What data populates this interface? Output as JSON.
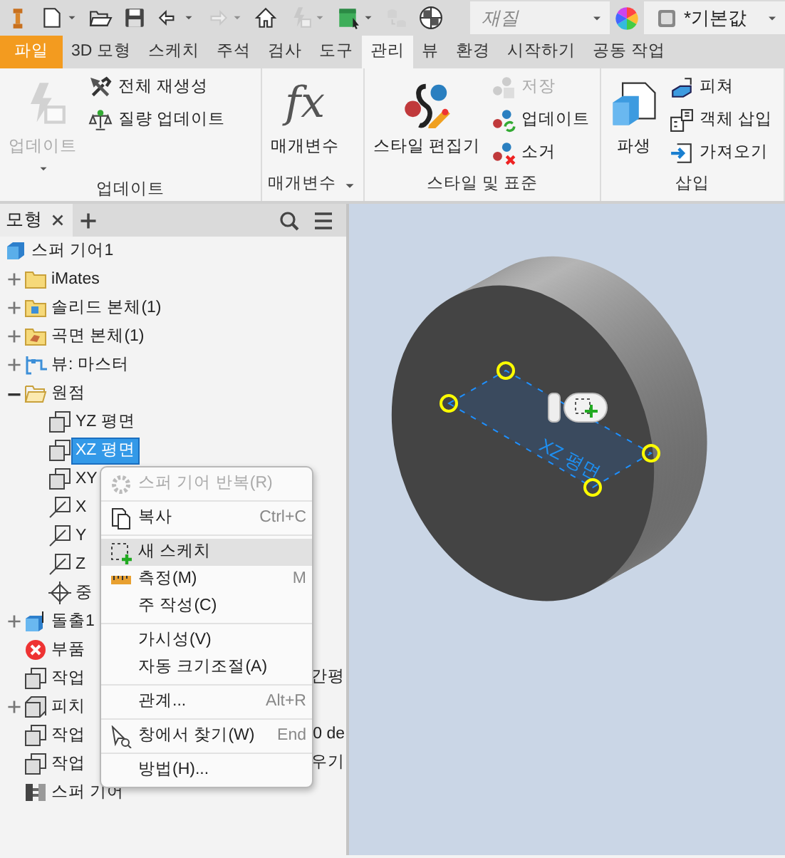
{
  "quick_access": [
    {
      "kind": "logo",
      "disabled": false
    },
    {
      "kind": "new",
      "menu": true,
      "disabled": false
    },
    {
      "kind": "open",
      "disabled": false
    },
    {
      "kind": "save",
      "disabled": false
    },
    {
      "kind": "undo",
      "menu": true,
      "disabled": false
    },
    {
      "kind": "redo",
      "menu": true,
      "disabled": true
    },
    {
      "kind": "home",
      "disabled": false
    },
    {
      "kind": "update",
      "menu": true,
      "disabled": true
    },
    {
      "kind": "select",
      "menu": true,
      "disabled": false
    },
    {
      "kind": "database",
      "disabled": true
    },
    {
      "kind": "ball",
      "disabled": false
    }
  ],
  "material": {
    "placeholder": "재질"
  },
  "appearance": {
    "value": "*기본값"
  },
  "ribbon_tabs": [
    {
      "label": "파일",
      "kind": "app",
      "selected": false
    },
    {
      "label": "3D 모형",
      "kind": "tab",
      "selected": false
    },
    {
      "label": "스케치",
      "kind": "tab",
      "selected": false
    },
    {
      "label": "주석",
      "kind": "tab",
      "selected": false
    },
    {
      "label": "검사",
      "kind": "tab",
      "selected": false
    },
    {
      "label": "도구",
      "kind": "tab",
      "selected": false
    },
    {
      "label": "관리",
      "kind": "tab",
      "selected": true
    },
    {
      "label": "뷰",
      "kind": "tab",
      "selected": false
    },
    {
      "label": "환경",
      "kind": "tab",
      "selected": false
    },
    {
      "label": "시작하기",
      "kind": "tab",
      "selected": false
    },
    {
      "label": "공동 작업",
      "kind": "tab",
      "selected": false
    }
  ],
  "ribbon_groups": [
    {
      "title": "업데이트",
      "big": [
        {
          "label": "업데이트",
          "kind": "update",
          "disabled": true,
          "menu": true
        }
      ],
      "small": [
        {
          "label": "전체 재생성",
          "kind": "rebuild",
          "disabled": false
        },
        {
          "label": "질량 업데이트",
          "kind": "mass",
          "disabled": false
        }
      ]
    },
    {
      "title": "매개변수",
      "menu": true,
      "big": [
        {
          "label": "매개변수",
          "kind": "fx",
          "glyph": "fx",
          "disabled": false
        }
      ]
    },
    {
      "title": "스타일 및 표준",
      "big": [
        {
          "label": "스타일 편집기",
          "kind": "style",
          "disabled": false
        }
      ],
      "small": [
        {
          "label": "저장",
          "kind": "style-save",
          "disabled": true
        },
        {
          "label": "업데이트",
          "kind": "style-update",
          "disabled": false
        },
        {
          "label": "소거",
          "kind": "style-purge",
          "disabled": false
        }
      ]
    },
    {
      "title": "삽입",
      "big": [
        {
          "label": "파생",
          "kind": "derive",
          "disabled": false
        }
      ],
      "small": [
        {
          "label": "피쳐",
          "kind": "feature",
          "disabled": false
        },
        {
          "label": "객체 삽입",
          "kind": "object",
          "disabled": false
        },
        {
          "label": "가져오기",
          "kind": "import",
          "disabled": false
        }
      ]
    }
  ],
  "browser": {
    "tabs": [
      {
        "label": "모형",
        "selected": true
      }
    ],
    "tree": [
      {
        "label": "스퍼 기어1",
        "kind": "part",
        "selected": false,
        "children": [
          {
            "label": "iMates",
            "kind": "folder",
            "expanded": false,
            "selected": false
          },
          {
            "label": "솔리드 본체(1)",
            "kind": "solid-folder",
            "expanded": false,
            "selected": false
          },
          {
            "label": "곡면 본체(1)",
            "kind": "surface-folder",
            "expanded": false,
            "selected": false
          },
          {
            "label": "뷰: 마스터",
            "kind": "view",
            "expanded": false,
            "selected": false
          },
          {
            "label": "원점",
            "kind": "origin",
            "expanded": true,
            "selected": false,
            "children": [
              {
                "label": "YZ 평면",
                "kind": "plane",
                "selected": false
              },
              {
                "label": "XZ 평면",
                "kind": "plane",
                "selected": true
              },
              {
                "label": "XY",
                "kind": "plane",
                "selected": false
              },
              {
                "label": "X",
                "kind": "axis",
                "selected": false
              },
              {
                "label": "Y",
                "kind": "axis",
                "selected": false
              },
              {
                "label": "Z",
                "kind": "axis",
                "selected": false
              },
              {
                "label": "중",
                "kind": "point",
                "selected": false
              }
            ]
          },
          {
            "label": "돌출1",
            "kind": "extrude",
            "expanded": false,
            "selected": false
          },
          {
            "label": "부품",
            "kind": "error",
            "selected": false
          },
          {
            "label": "작업",
            "kind": "workplane",
            "selected": false,
            "tail": "간평"
          },
          {
            "label": "피치",
            "kind": "pitch",
            "expanded": false,
            "selected": false
          },
          {
            "label": "작업",
            "kind": "workplane",
            "selected": false,
            "tail": "0 de"
          },
          {
            "label": "작업",
            "kind": "workplane",
            "selected": false,
            "tail": "우기"
          },
          {
            "label": "스퍼 기어",
            "kind": "gear",
            "selected": false
          }
        ]
      }
    ]
  },
  "context_menu": {
    "groups": [
      [
        {
          "label": "스퍼 기어 반복(R)",
          "kind": "pattern",
          "disabled": true,
          "selected": false
        }
      ],
      [
        {
          "label": "복사",
          "shortcut": "Ctrl+C",
          "kind": "copy",
          "disabled": false,
          "selected": false
        }
      ],
      [
        {
          "label": "새 스케치",
          "kind": "sketch",
          "disabled": false,
          "selected": true
        },
        {
          "label": "측정(M)",
          "shortcut": "M",
          "kind": "measure",
          "disabled": false,
          "selected": false
        },
        {
          "label": "주 작성(C)",
          "disabled": false,
          "selected": false
        }
      ],
      [
        {
          "label": "가시성(V)",
          "disabled": false,
          "selected": false
        },
        {
          "label": "자동 크기조절(A)",
          "disabled": false,
          "selected": false
        }
      ],
      [
        {
          "label": "관계...",
          "shortcut": "Alt+R",
          "disabled": false,
          "selected": false
        }
      ],
      [
        {
          "label": "창에서 찾기(W)",
          "shortcut": "End",
          "kind": "find",
          "disabled": false,
          "selected": false
        }
      ],
      [
        {
          "label": "방법(H)...",
          "disabled": false,
          "selected": false
        }
      ]
    ]
  },
  "viewport": {
    "plane_label": "XZ 평면"
  }
}
